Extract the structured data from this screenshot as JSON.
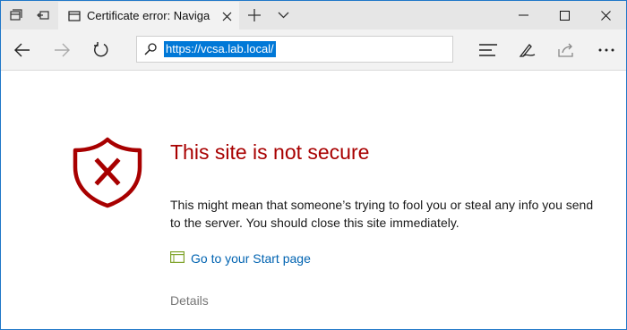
{
  "browser": {
    "tab": {
      "title": "Certificate error: Naviga"
    },
    "address_bar": {
      "url": "https://vcsa.lab.local/"
    },
    "icons": {
      "tab_manager": "tabs-aside-icon",
      "tab_restore": "tab-restore-icon",
      "tab_favicon": "page-icon",
      "tab_close": "close-icon",
      "new_tab": "plus-icon",
      "tab_overflow": "chevron-down-icon",
      "minimize": "minimize-icon",
      "maximize": "maximize-icon",
      "close_window": "close-icon",
      "back": "back-arrow-icon",
      "forward": "forward-arrow-icon",
      "refresh": "refresh-icon",
      "address_lock": "lock-icon",
      "hub": "hub-icon",
      "web_note": "pen-icon",
      "share": "share-icon",
      "more": "more-icon"
    }
  },
  "page": {
    "title": "This site is not secure",
    "description": "This might mean that someone’s trying to fool you or steal any info you send to the server. You should close this site immediately.",
    "start_link": "Go to your Start page",
    "details_link": "Details",
    "icons": {
      "warning": "shield-error-icon",
      "start_page": "start-page-icon"
    }
  },
  "colors": {
    "error_red": "#a80000",
    "link_blue": "#0063b1",
    "url_highlight": "#0078d7",
    "window_border": "#1f77c8"
  }
}
